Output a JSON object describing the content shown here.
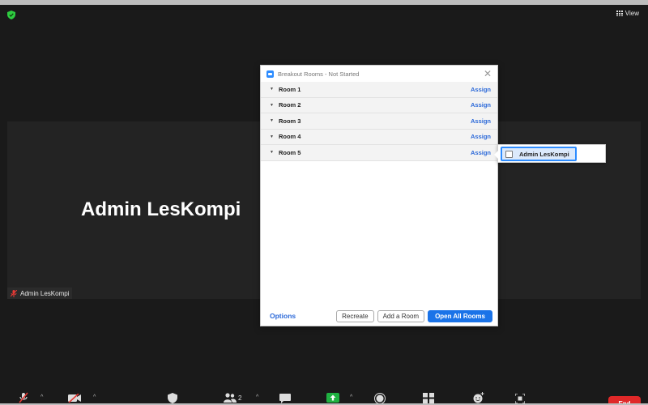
{
  "topbar": {
    "view_label": "View"
  },
  "meeting": {
    "participant_name": "Admin LesKompi",
    "name_tag": "Admin LesKompi"
  },
  "dialog": {
    "title": "Breakout Rooms - Not Started",
    "rooms": [
      {
        "label": "Room 1",
        "assign": "Assign"
      },
      {
        "label": "Room 2",
        "assign": "Assign"
      },
      {
        "label": "Room 3",
        "assign": "Assign"
      },
      {
        "label": "Room 4",
        "assign": "Assign"
      },
      {
        "label": "Room 5",
        "assign": "Assign"
      }
    ],
    "options_label": "Options",
    "recreate_label": "Recreate",
    "add_room_label": "Add a Room",
    "open_all_label": "Open All Rooms"
  },
  "assign_popup": {
    "participant": "Admin LesKompi",
    "checked": false
  },
  "toolbar": {
    "participants_count": "2",
    "end_label": "End"
  },
  "icons": {
    "shield": "shield-icon",
    "view": "grid-view-icon",
    "mic": "microphone-muted-icon",
    "video": "video-off-icon",
    "security": "security-shield-icon",
    "participants": "participants-icon",
    "chat": "chat-icon",
    "share": "share-screen-icon",
    "record": "record-icon",
    "breakout": "breakout-rooms-icon",
    "reactions": "reactions-icon",
    "apps": "apps-icon"
  },
  "colors": {
    "accent": "#2d8cff",
    "link": "#2d6ad9",
    "share": "#1fb141",
    "end": "#e02828",
    "muted": "#e53935"
  }
}
